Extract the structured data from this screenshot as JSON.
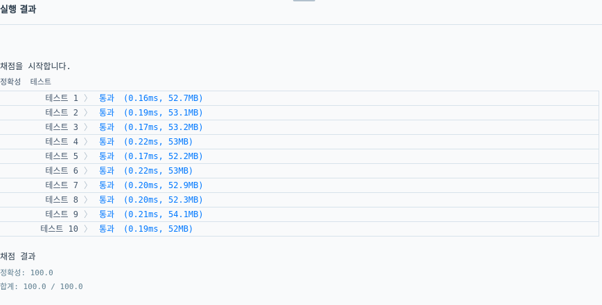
{
  "header": {
    "title": "실행 결과"
  },
  "output": {
    "start_message": "채점을 시작합니다.",
    "section_label": "정확성  테스트",
    "tests": [
      {
        "name": "테스트 1",
        "result": "통과",
        "stats": "(0.16ms, 52.7MB)"
      },
      {
        "name": "테스트 2",
        "result": "통과",
        "stats": "(0.19ms, 53.1MB)"
      },
      {
        "name": "테스트 3",
        "result": "통과",
        "stats": "(0.17ms, 53.2MB)"
      },
      {
        "name": "테스트 4",
        "result": "통과",
        "stats": "(0.22ms, 53MB)"
      },
      {
        "name": "테스트 5",
        "result": "통과",
        "stats": "(0.17ms, 52.2MB)"
      },
      {
        "name": "테스트 6",
        "result": "통과",
        "stats": "(0.22ms, 53MB)"
      },
      {
        "name": "테스트 7",
        "result": "통과",
        "stats": "(0.20ms, 52.9MB)"
      },
      {
        "name": "테스트 8",
        "result": "통과",
        "stats": "(0.20ms, 52.3MB)"
      },
      {
        "name": "테스트 9",
        "result": "통과",
        "stats": "(0.21ms, 54.1MB)"
      },
      {
        "name": "테스트 10",
        "result": "통과",
        "stats": "(0.19ms, 52MB)"
      }
    ],
    "chevron": "〉"
  },
  "summary": {
    "title": "채점 결과",
    "accuracy": "정확성: 100.0",
    "total": "합계: 100.0 / 100.0"
  },
  "colors": {
    "pass": "#0078ff",
    "text": "#263747",
    "muted": "#5f7f90",
    "border": "#d7e2eb",
    "background": "#f9fafb"
  }
}
